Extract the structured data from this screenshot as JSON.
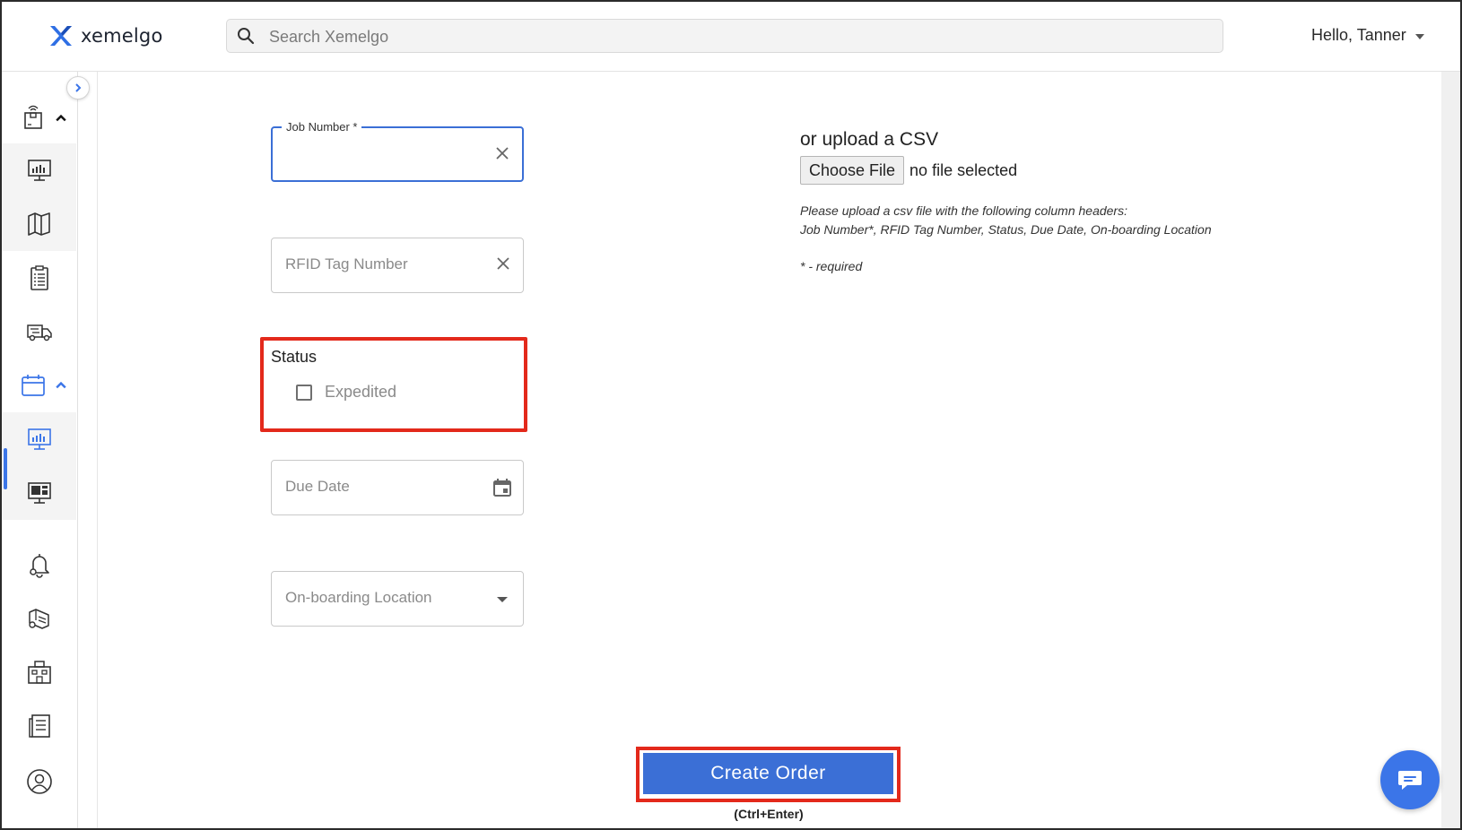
{
  "app": {
    "name": "xemelgo"
  },
  "search": {
    "placeholder": "Search Xemelgo"
  },
  "user": {
    "greeting": "Hello, Tanner"
  },
  "sidebar": {
    "items": [
      {
        "icon": "package-rfid-icon",
        "expanded": true
      },
      {
        "icon": "monitor-chart-icon"
      },
      {
        "icon": "map-icon"
      },
      {
        "icon": "clipboard-list-icon"
      },
      {
        "icon": "delivery-truck-icon"
      },
      {
        "icon": "calendar-icon",
        "expanded": true,
        "active": true
      },
      {
        "icon": "monitor-chart-icon"
      },
      {
        "icon": "monitor-dashboard-icon"
      },
      {
        "icon": "bell-settings-icon"
      },
      {
        "icon": "tags-settings-icon"
      },
      {
        "icon": "building-icon"
      },
      {
        "icon": "document-list-icon"
      },
      {
        "icon": "user-circle-icon"
      }
    ]
  },
  "form": {
    "job_number_label": "Job Number *",
    "job_number_value": "",
    "rfid_placeholder": "RFID Tag Number",
    "status_label": "Status",
    "expedited_label": "Expedited",
    "expedited_checked": false,
    "due_date_placeholder": "Due Date",
    "location_placeholder": "On-boarding Location"
  },
  "csv": {
    "title": "or upload a CSV",
    "choose_file_label": "Choose File",
    "file_status": "no file selected",
    "instructions_line1": "Please upload a csv file with the following column headers:",
    "instructions_line2": "Job Number*, RFID Tag Number, Status, Due Date, On-boarding Location",
    "required_note": "* - required"
  },
  "actions": {
    "create_label": "Create Order",
    "shortcut_label": "(Ctrl+Enter)"
  },
  "colors": {
    "accent": "#3b6fd6",
    "highlight": "#e3291b"
  }
}
